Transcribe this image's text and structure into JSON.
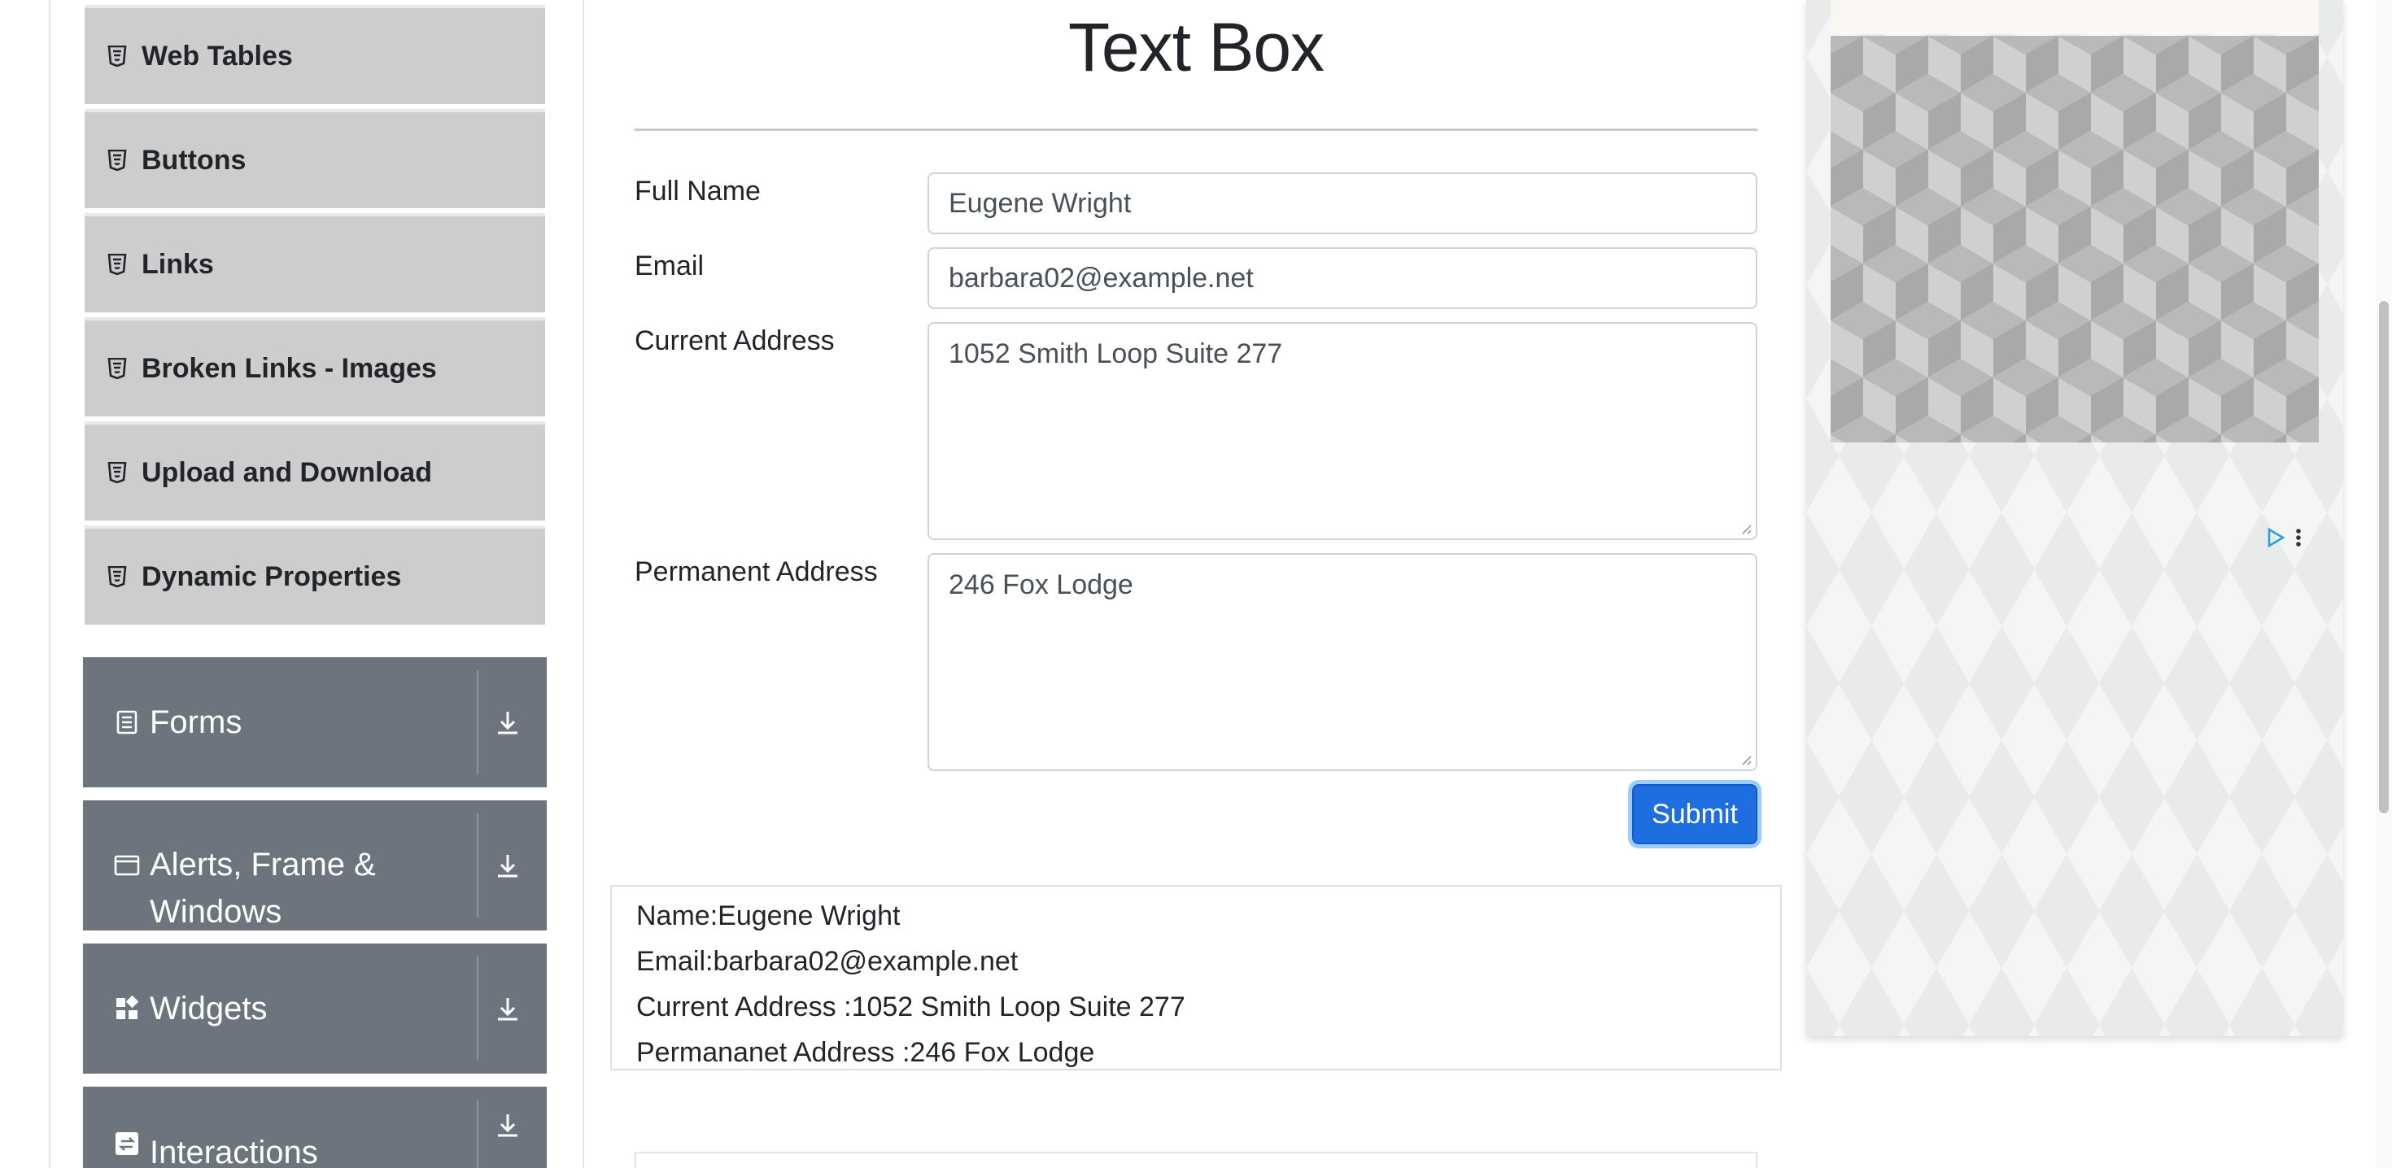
{
  "page": {
    "title": "Text Box"
  },
  "sidebar": {
    "subitems": [
      {
        "label": "Web Tables"
      },
      {
        "label": "Buttons"
      },
      {
        "label": "Links"
      },
      {
        "label": "Broken Links - Images"
      },
      {
        "label": "Upload and Download"
      },
      {
        "label": "Dynamic Properties"
      }
    ],
    "groups": [
      {
        "label": "Forms",
        "icon": "form-icon"
      },
      {
        "label": "Alerts, Frame & Windows",
        "icon": "window-icon"
      },
      {
        "label": "Widgets",
        "icon": "widgets-icon"
      },
      {
        "label": "Interactions",
        "icon": "interactions-icon"
      }
    ]
  },
  "form": {
    "full_name": {
      "label": "Full Name",
      "value": "Eugene Wright"
    },
    "email": {
      "label": "Email",
      "value": "barbara02@example.net"
    },
    "current_address": {
      "label": "Current Address",
      "value": "1052 Smith Loop Suite 277"
    },
    "permanent_address": {
      "label": "Permanent Address",
      "value": "246 Fox Lodge"
    },
    "submit_label": "Submit"
  },
  "output": {
    "name": "Name:Eugene Wright",
    "email": "Email:barbara02@example.net",
    "current_address": "Current Address :1052 Smith Loop Suite 277",
    "permanent_address": "Permananet Address :246 Fox Lodge"
  },
  "colors": {
    "submit": "#1e6ee0",
    "group_bg": "#6c757d",
    "subitem_bg": "#cdcdcd"
  }
}
